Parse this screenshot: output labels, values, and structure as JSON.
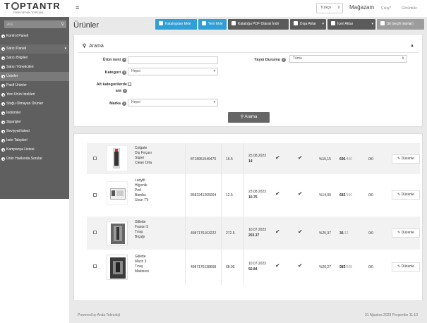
{
  "brand": {
    "name": "T  PTANTR",
    "tagline": "TÜRKİYE'NİN TOPTANI"
  },
  "topbar": {
    "language": "Türkçe",
    "store": "Mağazam",
    "logout": "Çıkış?",
    "view": "Görüntüle"
  },
  "sidebar": {
    "search_placeholder": "Ara",
    "items": [
      {
        "label": "Kontrol Paneli"
      },
      {
        "label": "Satıcı Paneli"
      },
      {
        "label": "Satıcı Bilgileri"
      },
      {
        "label": "Satıcı Yöneticileri"
      },
      {
        "label": "Ürünler"
      },
      {
        "label": "Pasif Ürünler"
      },
      {
        "label": "Yeni Ürün İstekleri"
      },
      {
        "label": "Stoğu Olmayan Ürünler"
      },
      {
        "label": "İndirimler"
      },
      {
        "label": "Siparişler"
      },
      {
        "label": "Seviyyat listesi"
      },
      {
        "label": "İade Talepleri"
      },
      {
        "label": "Kampanya Listesi"
      },
      {
        "label": "Ürün Hakkında Sorular"
      }
    ]
  },
  "page": {
    "title": "Ürünler"
  },
  "toolbar": {
    "add_from_catalog": "Katalogdan Ekle",
    "add_new": "Yeni Ekle",
    "catalog_pdf": "Kataloğu PDF Olarak İndir",
    "export": "Dışa Aktar",
    "import": "İçeri Aktar",
    "delete_selected": "Sil (seçili olanlar)"
  },
  "search": {
    "title": "Arama",
    "product_name_label": "Ürün ismi",
    "product_name_value": "",
    "category_label": "Kategori",
    "category_value": "Hepsi",
    "subcategory_label_1": "Alt kategorilerde",
    "subcategory_label_2": "ara",
    "brand_label": "Marka",
    "brand_value": "Hepsi",
    "publish_label": "Yayın Durumu",
    "publish_value": "Tümü",
    "search_button": "Arama"
  },
  "products": [
    {
      "name_lines": [
        "Colgate",
        "Diş Fırçası",
        "Süper",
        "Clean Orta"
      ],
      "barcode": "8718951549470",
      "price": "16.5",
      "date": "25.08.2023",
      "date_sub": "14",
      "margin": "%15,15",
      "stock": "696",
      "stock_total": "/400",
      "ratio": "0/0",
      "edit": "Düzenle"
    },
    {
      "name_lines": [
        "Ladyfit",
        "Hijyenik",
        "Ped",
        "Bambu",
        "Uzun 7'li"
      ],
      "barcode": "8682241205004",
      "price": "12.5",
      "date": "23.08.2023",
      "date_sub": "10.75",
      "margin": "%14,00",
      "stock": "683",
      "stock_total": "/196",
      "ratio": "0/0",
      "edit": "Düzenle"
    },
    {
      "name_lines": [
        "Gillette",
        "Fusion 5",
        "Tıraş",
        "Bıçağı"
      ],
      "barcode": "4987176103222",
      "price": "272.5",
      "date": "10.07.2023",
      "date_sub": "203.37",
      "margin": "%25,37",
      "stock": "36",
      "stock_total": "/12",
      "ratio": "0/0",
      "edit": "Düzenle"
    },
    {
      "name_lines": [
        "Gillette",
        "Mach 3",
        "Tıraş",
        "Makinesi"
      ],
      "barcode": "4987176138668",
      "price": "68.95",
      "date": "10.07.2023",
      "date_sub": "50.84",
      "margin": "%26,27",
      "stock": "983",
      "stock_total": "/208",
      "ratio": "0/0",
      "edit": "Düzenle"
    }
  ],
  "footer": {
    "left": "Powered by Anda Teknoloji",
    "right": "31 Ağustos 2023 Perşembe 11:10"
  },
  "colors": {
    "accent": "#2f9fd8",
    "sidebar": "#5f5f5f",
    "background": "#e9e9e9"
  }
}
